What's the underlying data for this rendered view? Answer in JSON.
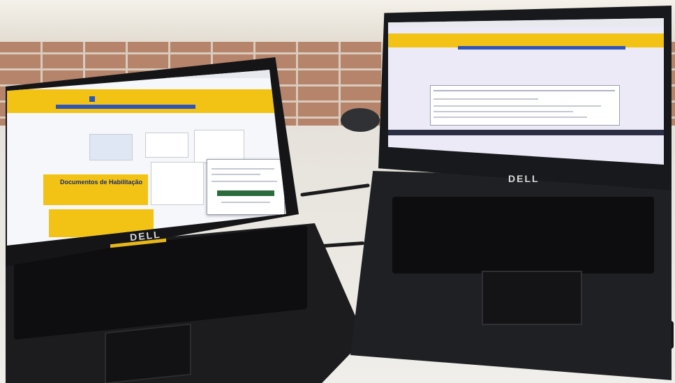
{
  "photo": {
    "left_laptop": {
      "brand": "DELL",
      "screen": {
        "banner_title": "Documentos de Habilitação"
      }
    },
    "right_laptop": {
      "brand": "DELL"
    }
  },
  "colors": {
    "banco_yellow": "#f2c315",
    "banco_blue": "#2f55b8",
    "laptop_black": "#18191c",
    "brick": "#b5846a"
  }
}
